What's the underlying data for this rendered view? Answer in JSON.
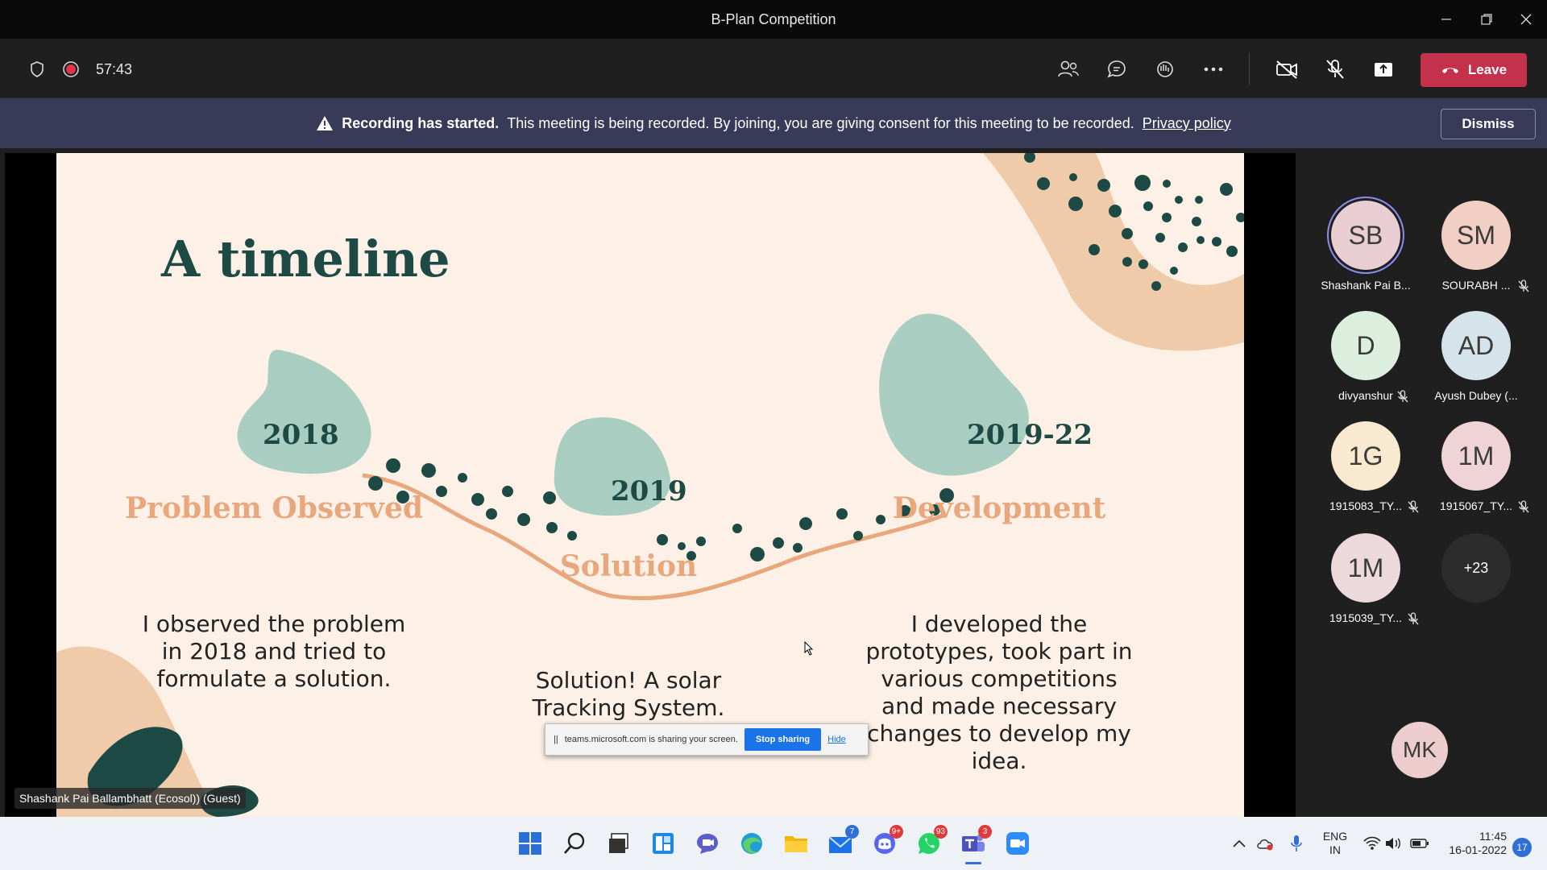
{
  "window": {
    "title": "B-Plan Competition"
  },
  "toolbar": {
    "timer": "57:43",
    "leave_label": "Leave"
  },
  "banner": {
    "bold": "Recording has started.",
    "message": "This meeting is being recorded. By joining, you are giving consent for this meeting to be recorded.",
    "link": "Privacy policy",
    "dismiss_label": "Dismiss"
  },
  "slide": {
    "title": "A timeline",
    "milestones": [
      {
        "year": "2018",
        "heading": "Problem Observed",
        "body": [
          "I observed the problem",
          "in 2018 and tried to",
          "formulate a solution."
        ]
      },
      {
        "year": "2019",
        "heading": "Solution",
        "body": [
          "Solution! A solar",
          "Tracking System."
        ]
      },
      {
        "year": "2019-22",
        "heading": "Development",
        "body": [
          "I developed the",
          "prototypes, took part in",
          "various competitions",
          "and made necessary",
          "changes to develop my",
          "idea."
        ]
      }
    ]
  },
  "share_bar": {
    "message": "teams.microsoft.com is sharing your screen.",
    "stop_label": "Stop sharing",
    "hide_label": "Hide"
  },
  "speaker_label": "Shashank Pai Ballambhatt (Ecosol)) (Guest)",
  "participants": [
    {
      "initials": "SB",
      "name": "Shashank Pai B...",
      "color": "#e8cdd3",
      "muted": false
    },
    {
      "initials": "SM",
      "name": "SOURABH ...",
      "color": "#f2cfc4",
      "muted": true
    },
    {
      "initials": "D",
      "name": "divyanshur",
      "color": "#dceede",
      "muted": true
    },
    {
      "initials": "AD",
      "name": "Ayush Dubey (...",
      "color": "#d4e4ea",
      "muted": false
    },
    {
      "initials": "1G",
      "name": "1915083_TY...",
      "color": "#f8e9d0",
      "muted": true
    },
    {
      "initials": "1M",
      "name": "1915067_TY...",
      "color": "#efd3d6",
      "muted": true
    },
    {
      "initials": "1M",
      "name": "1915039_TY...",
      "color": "#ebd9dc",
      "muted": true
    }
  ],
  "overflow_count": "+23",
  "self_view": {
    "initials": "MK"
  },
  "taskbar": {
    "badges": {
      "teams_chat": "7",
      "discord": "9+",
      "whatsapp": "93",
      "teams": "3"
    },
    "language": "ENG",
    "region": "IN",
    "time": "11:45",
    "date": "16-01-2022",
    "notifications": "17"
  }
}
